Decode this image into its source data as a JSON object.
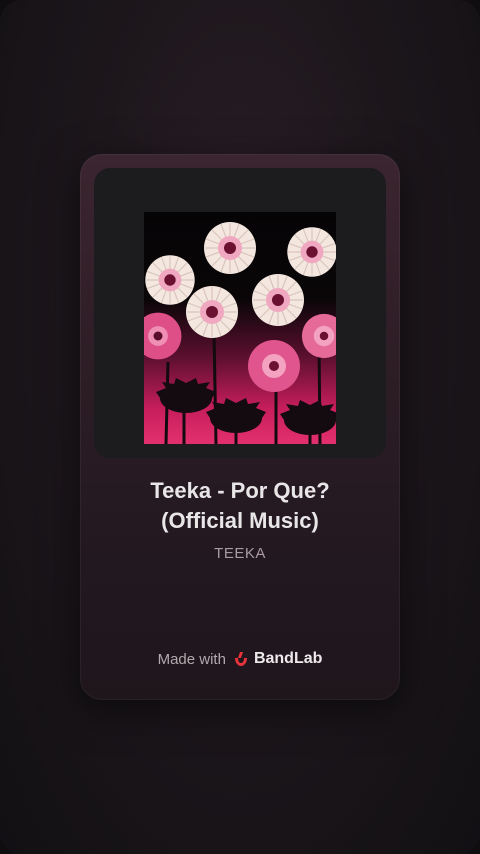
{
  "track": {
    "title_line1": "Teeka - Por Que?",
    "title_line2": "(Official Music)",
    "artist": "TEEKA"
  },
  "footer": {
    "made_with": "Made with",
    "brand": "BandLab",
    "brand_icon": "bandlab-logo-icon",
    "brand_color": "#e8333c"
  },
  "artwork": {
    "description_icon": "album-artwork"
  },
  "colors": {
    "background": "#1d171c",
    "card_top": "#3b2530",
    "title_text": "#e9e6e8",
    "artist_text": "#a99aa3"
  }
}
